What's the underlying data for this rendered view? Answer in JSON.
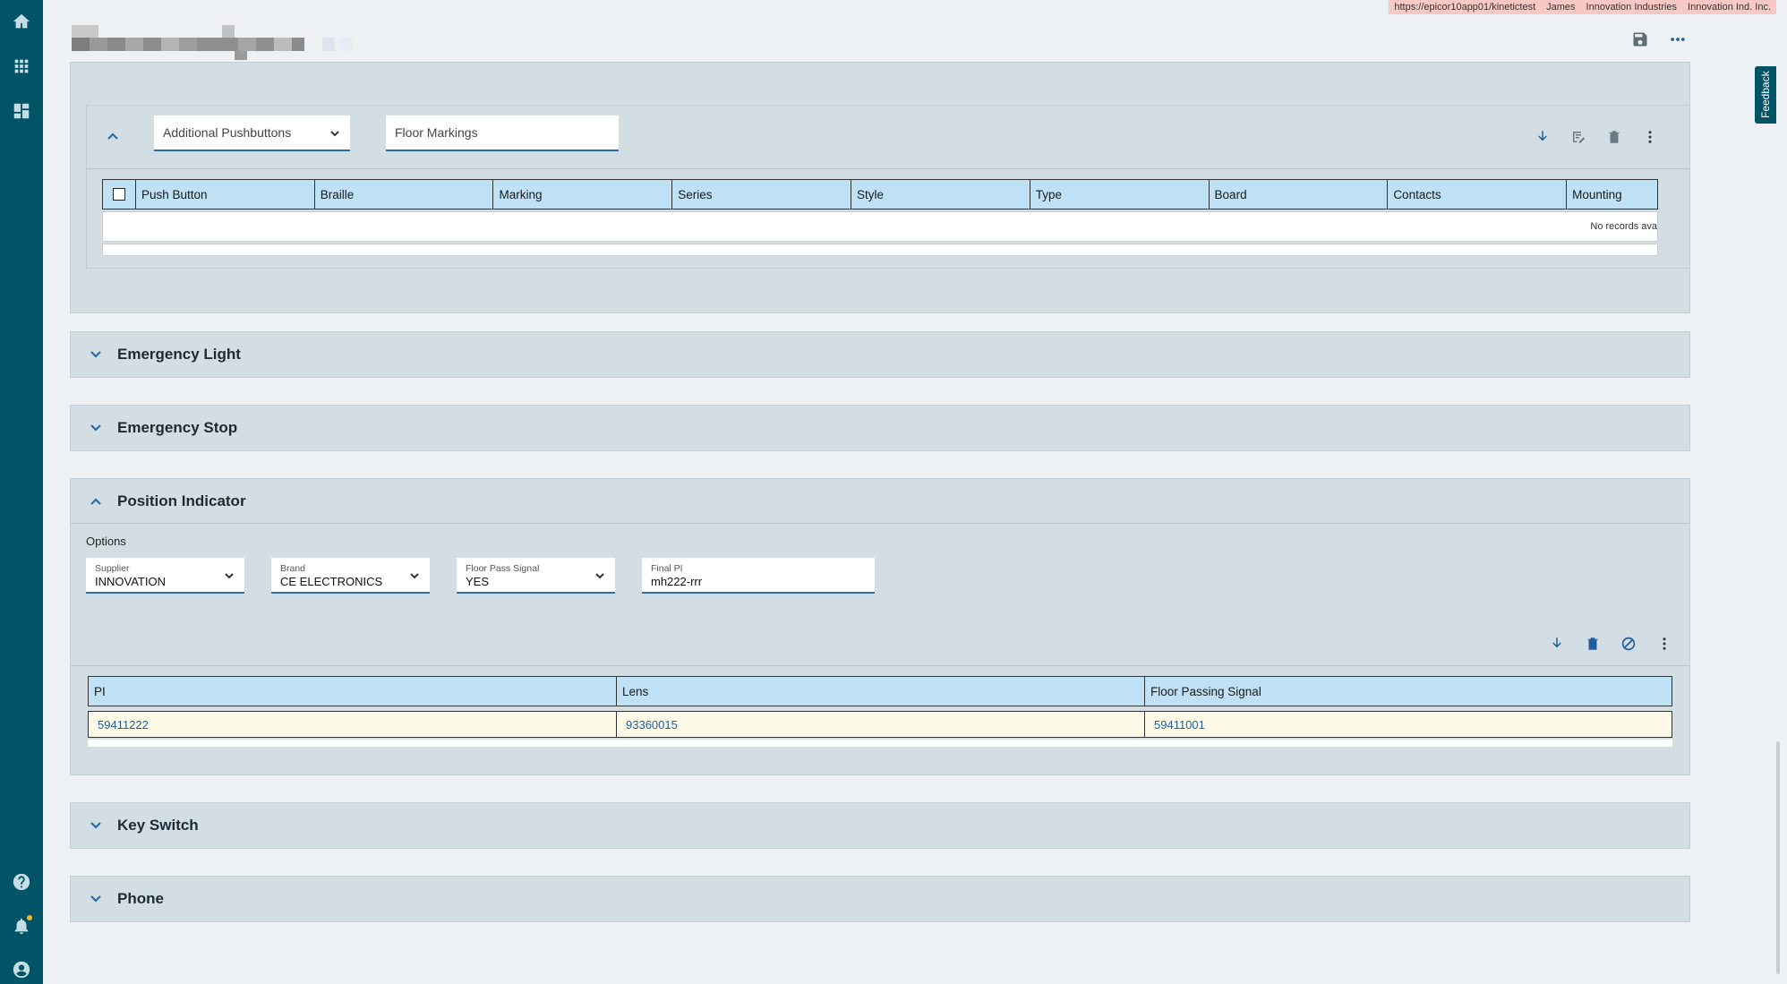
{
  "env": {
    "url": "https://epicor10app01/kinetictest",
    "user": "James",
    "company": "Innovation Industries",
    "site": "Innovation Ind. Inc."
  },
  "feedback_label": "Feedback",
  "pushbuttons": {
    "type_select": "Additional Pushbuttons",
    "sub_field": "Floor Markings",
    "columns": [
      "Push Button",
      "Braille",
      "Marking",
      "Series",
      "Style",
      "Type",
      "Board",
      "Contacts",
      "Mounting"
    ],
    "empty_text": "No records ava"
  },
  "sections": {
    "emergency_light": "Emergency Light",
    "emergency_stop": "Emergency Stop",
    "position_indicator": "Position Indicator",
    "key_switch": "Key Switch",
    "phone": "Phone"
  },
  "position_indicator": {
    "options_label": "Options",
    "supplier": {
      "label": "Supplier",
      "value": "INNOVATION"
    },
    "brand": {
      "label": "Brand",
      "value": "CE ELECTRONICS"
    },
    "floor_pass_signal": {
      "label": "Floor Pass Signal",
      "value": "YES"
    },
    "final_pi": {
      "label": "Final PI",
      "value": "mh222-rrr"
    },
    "columns": [
      "PI",
      "Lens",
      "Floor Passing Signal"
    ],
    "rows": [
      [
        "59411222",
        "93360015",
        "59411001"
      ]
    ]
  },
  "colors": {
    "rail": "#005466",
    "accent": "#2b6ca3",
    "grid_header": "#bfe1f5",
    "row_highlight": "#fdfbe8",
    "env_bar": "#f8c9c4"
  }
}
